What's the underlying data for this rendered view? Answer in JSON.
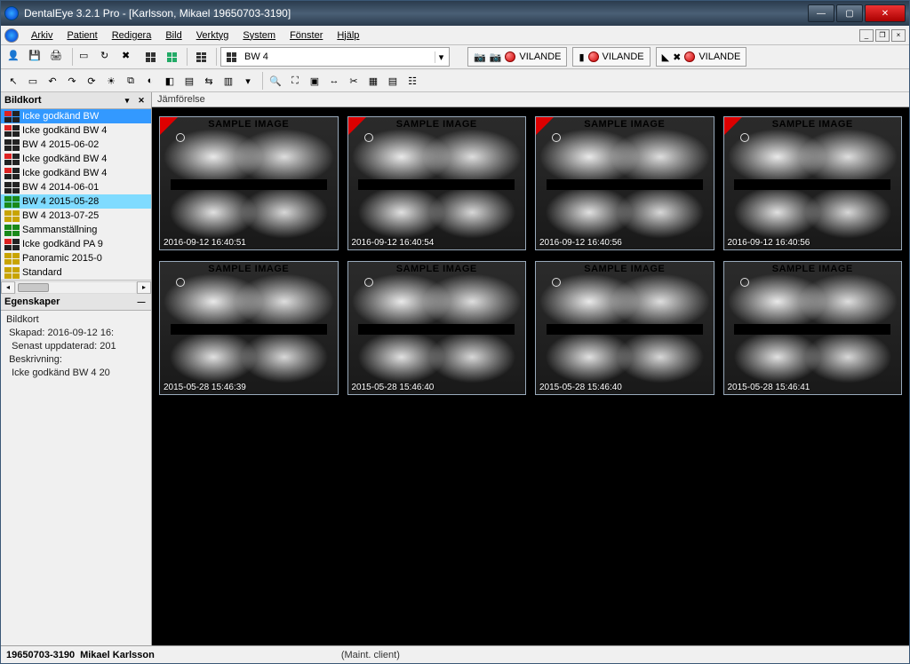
{
  "window": {
    "title": "DentalEye 3.2.1 Pro - [Karlsson, Mikael  19650703-3190]"
  },
  "menu": [
    "Arkiv",
    "Patient",
    "Redigera",
    "Bild",
    "Verktyg",
    "System",
    "Fönster",
    "Hjälp"
  ],
  "toolbar": {
    "template_dropdown": "BW 4",
    "status_labels": [
      "VILANDE",
      "VILANDE",
      "VILANDE"
    ]
  },
  "left": {
    "panel_title": "Bildkort",
    "items": [
      {
        "label": "Icke godkänd BW",
        "variant": "red",
        "selected": true
      },
      {
        "label": "Icke godkänd BW 4",
        "variant": "red"
      },
      {
        "label": "BW 4 2015-06-02",
        "variant": "plain"
      },
      {
        "label": "Icke godkänd BW 4",
        "variant": "red"
      },
      {
        "label": "Icke godkänd BW 4",
        "variant": "red"
      },
      {
        "label": "BW 4 2014-06-01",
        "variant": "plain"
      },
      {
        "label": "BW 4 2015-05-28",
        "variant": "green",
        "highlight": true
      },
      {
        "label": "BW 4 2013-07-25",
        "variant": "yellow"
      },
      {
        "label": "Sammanställning",
        "variant": "green"
      },
      {
        "label": "Icke godkänd PA 9",
        "variant": "red"
      },
      {
        "label": "Panoramic 2015-0",
        "variant": "yellow"
      },
      {
        "label": "Standard",
        "variant": "yellow"
      }
    ],
    "props_title": "Egenskaper",
    "props": {
      "group_label": "Bildkort",
      "created_label": "Skapad:",
      "created_value": "2016-09-12 16:",
      "updated_label": "Senast uppdaterad:",
      "updated_value": "201",
      "desc_label": "Beskrivning:",
      "desc_value": "Icke godkänd BW 4 20"
    }
  },
  "main": {
    "tab_label": "Jämförelse",
    "watermark": "SAMPLE IMAGE",
    "thumbs": [
      {
        "ts": "2016-09-12 16:40:51",
        "red": true
      },
      {
        "ts": "2016-09-12 16:40:54",
        "red": true
      },
      {
        "ts": "2016-09-12 16:40:56",
        "red": true
      },
      {
        "ts": "2016-09-12 16:40:56",
        "red": true
      },
      {
        "ts": "2015-05-28 15:46:39",
        "red": false
      },
      {
        "ts": "2015-05-28 15:46:40",
        "red": false
      },
      {
        "ts": "2015-05-28 15:46:40",
        "red": false
      },
      {
        "ts": "2015-05-28 15:46:41",
        "red": false
      }
    ]
  },
  "status": {
    "id": "19650703-3190",
    "name": "Mikael Karlsson",
    "mode": "(Maint. client)"
  }
}
